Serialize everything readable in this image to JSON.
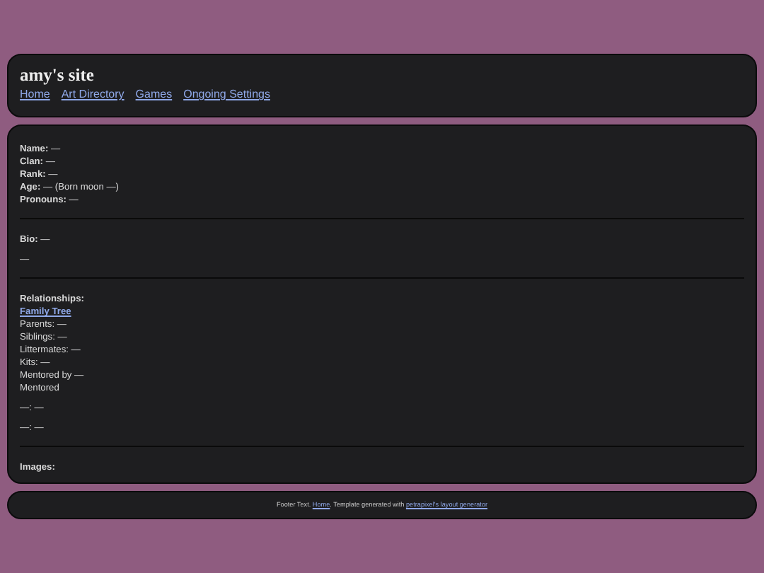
{
  "header": {
    "title": "amy's site",
    "nav": [
      "Home",
      "Art Directory",
      "Games",
      "Ongoing Settings"
    ]
  },
  "sections": [
    {
      "lines": [
        {
          "kind": "field",
          "text": "**Name:** —"
        },
        {
          "kind": "field",
          "text": "**Clan:** —"
        },
        {
          "kind": "field",
          "text": "**Rank:** —"
        },
        {
          "kind": "field",
          "text": "**Age:** — (Born moon —)"
        },
        {
          "kind": "field",
          "text": "**Pronouns:** —"
        }
      ]
    },
    {
      "lines": [
        {
          "kind": "field",
          "text": "**Bio:** —"
        },
        {
          "kind": "para",
          "text": "—"
        }
      ]
    },
    {
      "lines": [
        {
          "kind": "heading",
          "text": "Relationships:"
        },
        {
          "kind": "link",
          "text": "Family Tree"
        },
        {
          "kind": "plain",
          "text": "Parents: —"
        },
        {
          "kind": "plain",
          "text": "Siblings: —"
        },
        {
          "kind": "plain",
          "text": "Littermates: —"
        },
        {
          "kind": "plain",
          "text": "Kits: —"
        },
        {
          "kind": "plain",
          "text": "Mentored by —"
        },
        {
          "kind": "plain",
          "text": "Mentored"
        },
        {
          "kind": "para",
          "text": "—: —"
        },
        {
          "kind": "para",
          "text": "—: —"
        }
      ]
    },
    {
      "lines": [
        {
          "kind": "heading",
          "text": "Images:"
        }
      ]
    }
  ],
  "footer": {
    "parts": [
      {
        "kind": "text",
        "text": "Footer Text."
      },
      {
        "kind": "link",
        "text": "Home"
      },
      {
        "kind": "text",
        "text": ". Template generated with"
      },
      {
        "kind": "link",
        "text": "petrapixel's layout generator"
      }
    ]
  }
}
